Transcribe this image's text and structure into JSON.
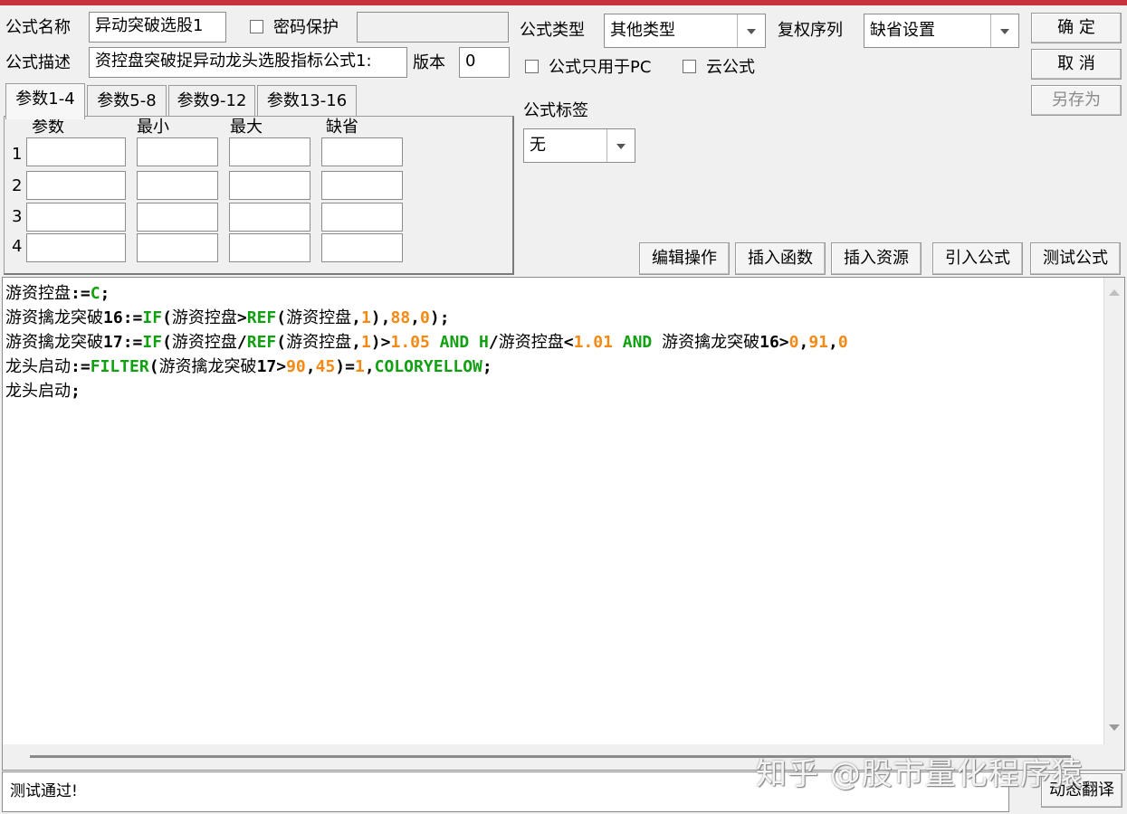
{
  "header": {
    "formula_name_label": "公式名称",
    "formula_name_value": "异动突破选股1",
    "password_label": "密码保护",
    "formula_desc_label": "公式描述",
    "formula_desc_value": "资控盘突破捉异动龙头选股指标公式1:",
    "version_label": "版本",
    "version_value": "0",
    "formula_type_label": "公式类型",
    "formula_type_value": "其他类型",
    "rights_label": "复权序列",
    "rights_value": "缺省设置",
    "pc_only_label": "公式只用于PC",
    "cloud_label": "云公式",
    "tag_label": "公式标签",
    "tag_value": "无"
  },
  "buttons": {
    "ok": "确 定",
    "cancel": "取 消",
    "save_as": "另存为",
    "edit_ops": "编辑操作",
    "insert_func": "插入函数",
    "insert_res": "插入资源",
    "import_formula": "引入公式",
    "test_formula": "测试公式",
    "dynamic_translate": "动态翻译"
  },
  "tabs": [
    "参数1-4",
    "参数5-8",
    "参数9-12",
    "参数13-16"
  ],
  "params": {
    "headers": [
      "参数",
      "最小",
      "最大",
      "缺省"
    ],
    "rows": [
      "1",
      "2",
      "3",
      "4"
    ]
  },
  "code": {
    "line1_name": "游资控盘",
    "line1_op": ":=",
    "line1_c": "C",
    "line1_end": ";",
    "line2_name": "游资擒龙突破",
    "line2_num": "16",
    "line2_op": ":=",
    "line2_if": "IF",
    "line2_p1": "(",
    "line2_v1": "游资控盘",
    "line2_gt": ">",
    "line2_ref": "REF",
    "line2_p2": "(",
    "line2_v2": "游资控盘",
    "line2_comma": ",",
    "line2_n1": "1",
    "line2_p3": "),",
    "line2_n2": "88",
    "line2_c2": ",",
    "line2_n3": "0",
    "line2_end": ");",
    "line3_name": "游资擒龙突破",
    "line3_num": "17",
    "line3_op": ":=",
    "line3_if": "IF",
    "line3_p1": "(",
    "line3_v1": "游资控盘",
    "line3_div": "/",
    "line3_ref": "REF",
    "line3_p2": "(",
    "line3_v2": "游资控盘",
    "line3_c1": ",",
    "line3_n1": "1",
    "line3_p3": ")>",
    "line3_n2": "1.05",
    "line3_and1": " AND ",
    "line3_h": "H",
    "line3_div2": "/",
    "line3_v3": "游资控盘",
    "line3_lt": "<",
    "line3_n3": "1.01",
    "line3_and2": " AND ",
    "line3_v4": "游资擒龙突破",
    "line3_num2": "16>",
    "line3_n4": "0",
    "line3_c2": ",",
    "line3_n5": "91",
    "line3_c3": ",",
    "line3_n6": "0",
    "line4_name": "龙头启动",
    "line4_op": ":=",
    "line4_filter": "FILTER",
    "line4_p1": "(",
    "line4_v1": "游资擒龙突破",
    "line4_num": "17>",
    "line4_n1": "90",
    "line4_c1": ",",
    "line4_n2": "45",
    "line4_p2": ")=",
    "line4_n3": "1",
    "line4_c2": ",",
    "line4_color": "COLORYELLOW",
    "line4_end": ";",
    "line5_name": "龙头启动",
    "line5_end": ";"
  },
  "status_text": "测试通过!",
  "watermark": "知乎 @股市量化程序猿",
  "colors": {
    "title_accent": "#c8323c",
    "keyword_green": "#11a011",
    "number_orange": "#f48a14"
  }
}
